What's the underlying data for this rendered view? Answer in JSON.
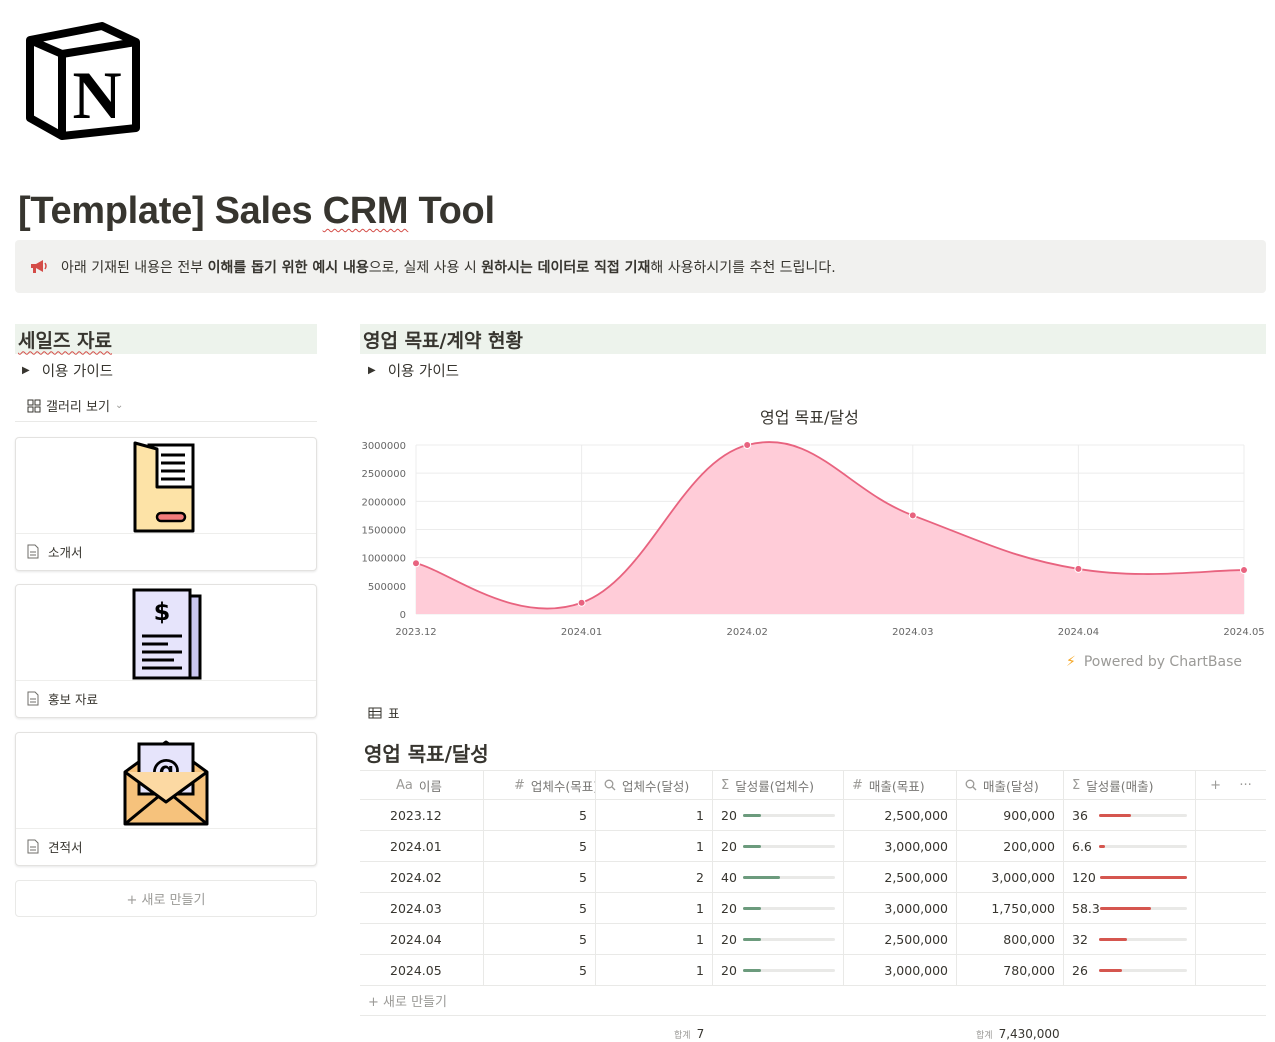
{
  "page": {
    "title_prefix": "[Template] Sales ",
    "title_crm": "CRM",
    "title_suffix": " Tool"
  },
  "callout": {
    "icon": "megaphone-icon",
    "parts": [
      "아래 기재된 내용은 전부 ",
      "이해를 돕기 위한 예시 내용",
      "으로, 실제 사용 시 ",
      "원하시는 데이터로 직접 기재",
      "해 사용하시기를 추천 드립니다."
    ]
  },
  "left": {
    "heading": "세일즈 자료",
    "toggle": "이용 가이드",
    "view_label": "갤러리 보기",
    "cards": [
      {
        "title": "소개서",
        "icon": "document-folder-icon"
      },
      {
        "title": "홍보 자료",
        "icon": "invoice-icon"
      },
      {
        "title": "견적서",
        "icon": "email-envelope-icon"
      }
    ],
    "new_label": "+ 새로 만들기"
  },
  "right": {
    "heading": "영업 목표/계약 현황",
    "toggle": "이용 가이드",
    "powered": "Powered by ChartBase",
    "table_view": "표",
    "table_title": "영업 목표/달성",
    "columns": [
      {
        "icon": "Aa",
        "label": "이름"
      },
      {
        "icon": "#",
        "label": "업체수(목표)"
      },
      {
        "icon": "search-icon",
        "label": "업체수(달성)"
      },
      {
        "icon": "Σ",
        "label": "달성률(업체수)"
      },
      {
        "icon": "#",
        "label": "매출(목표)"
      },
      {
        "icon": "search-icon",
        "label": "매출(달성)"
      },
      {
        "icon": "Σ",
        "label": "달성률(매출)"
      }
    ],
    "add_column": "+",
    "more": "···",
    "rows": [
      {
        "name": "2023.12",
        "target_cnt": "5",
        "done_cnt": "1",
        "rate_cnt": "20",
        "rate_cnt_pct": 20,
        "target_rev": "2,500,000",
        "done_rev": "900,000",
        "rate_rev": "36",
        "rate_rev_pct": 36
      },
      {
        "name": "2024.01",
        "target_cnt": "5",
        "done_cnt": "1",
        "rate_cnt": "20",
        "rate_cnt_pct": 20,
        "target_rev": "3,000,000",
        "done_rev": "200,000",
        "rate_rev": "6.6",
        "rate_rev_pct": 6.6
      },
      {
        "name": "2024.02",
        "target_cnt": "5",
        "done_cnt": "2",
        "rate_cnt": "40",
        "rate_cnt_pct": 40,
        "target_rev": "2,500,000",
        "done_rev": "3,000,000",
        "rate_rev": "120",
        "rate_rev_pct": 100
      },
      {
        "name": "2024.03",
        "target_cnt": "5",
        "done_cnt": "1",
        "rate_cnt": "20",
        "rate_cnt_pct": 20,
        "target_rev": "3,000,000",
        "done_rev": "1,750,000",
        "rate_rev": "58.3",
        "rate_rev_pct": 58.3
      },
      {
        "name": "2024.04",
        "target_cnt": "5",
        "done_cnt": "1",
        "rate_cnt": "20",
        "rate_cnt_pct": 20,
        "target_rev": "2,500,000",
        "done_rev": "800,000",
        "rate_rev": "32",
        "rate_rev_pct": 32
      },
      {
        "name": "2024.05",
        "target_cnt": "5",
        "done_cnt": "1",
        "rate_cnt": "20",
        "rate_cnt_pct": 20,
        "target_rev": "3,000,000",
        "done_rev": "780,000",
        "rate_rev": "26",
        "rate_rev_pct": 26
      }
    ],
    "new_row": "+ 새로 만들기",
    "sum_label": "합계",
    "sum_cnt": "7",
    "sum_rev": "7,430,000"
  },
  "chart_data": {
    "type": "area",
    "title": "영업 목표/달성",
    "categories": [
      "2023.12",
      "2024.01",
      "2024.02",
      "2024.03",
      "2024.04",
      "2024.05"
    ],
    "values": [
      900000,
      200000,
      3000000,
      1750000,
      800000,
      780000
    ],
    "ylim": [
      0,
      3000000
    ],
    "yticks": [
      "3000000",
      "2500000",
      "2000000",
      "1500000",
      "1000000",
      "500000",
      "0"
    ],
    "color": "#e8637f",
    "fill": "#ffccd8",
    "grid": true,
    "legend": "none"
  }
}
